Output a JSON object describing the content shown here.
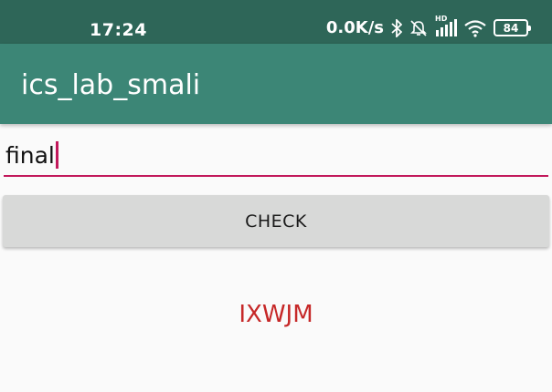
{
  "status_bar": {
    "time": "17:24",
    "network_speed": "0.0K/s",
    "network_type": "HD",
    "battery": "84",
    "icons": [
      "bluetooth-icon",
      "alarm-off-icon",
      "signal-icon",
      "wifi-icon",
      "battery-icon"
    ]
  },
  "app_bar": {
    "title": "ics_lab_smali"
  },
  "input": {
    "value": "final"
  },
  "check_button": {
    "label": "CHECK"
  },
  "result": {
    "text": "IXWJM"
  },
  "colors": {
    "status_bar": "#2e6658",
    "app_bar": "#3c8676",
    "accent": "#c2185b",
    "result": "#c62828",
    "button": "#d8d9d8"
  }
}
